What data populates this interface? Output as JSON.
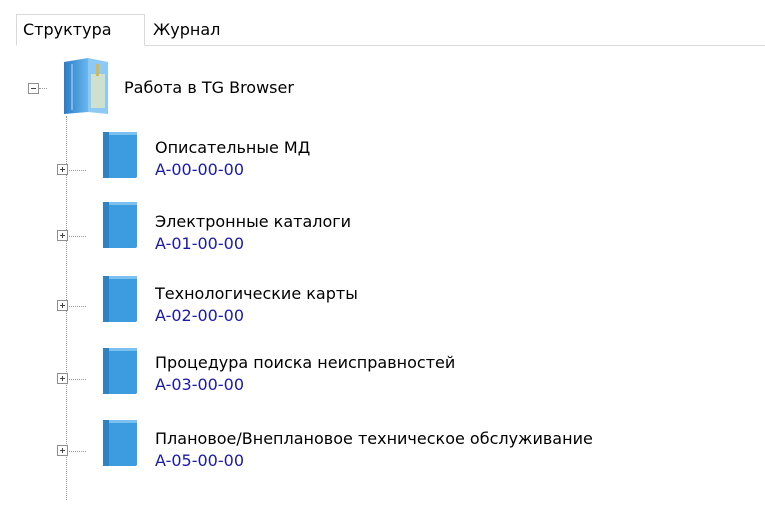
{
  "tabs": [
    {
      "label": "Структура",
      "active": true
    },
    {
      "label": "Журнал",
      "active": false
    }
  ],
  "tree": {
    "root": {
      "label": "Работа в TG Browser",
      "icon": "folder-book-icon",
      "expanded": true
    },
    "items": [
      {
        "label": "Описательные МД",
        "code": "A-00-00-00",
        "icon": "book-icon",
        "expanded": false
      },
      {
        "label": "Электронные каталоги",
        "code": "A-01-00-00",
        "icon": "book-icon",
        "expanded": false
      },
      {
        "label": "Технологические карты",
        "code": "A-02-00-00",
        "icon": "book-icon",
        "expanded": false
      },
      {
        "label": "Процедура поиска неисправностей",
        "code": "A-03-00-00",
        "icon": "book-icon",
        "expanded": false
      },
      {
        "label": "Плановое/Внеплановое техническое обслуживание",
        "code": "A-05-00-00",
        "icon": "book-icon",
        "expanded": false
      }
    ]
  },
  "colors": {
    "code_text": "#1a1aa8",
    "book_blue": "#3d9be0"
  }
}
